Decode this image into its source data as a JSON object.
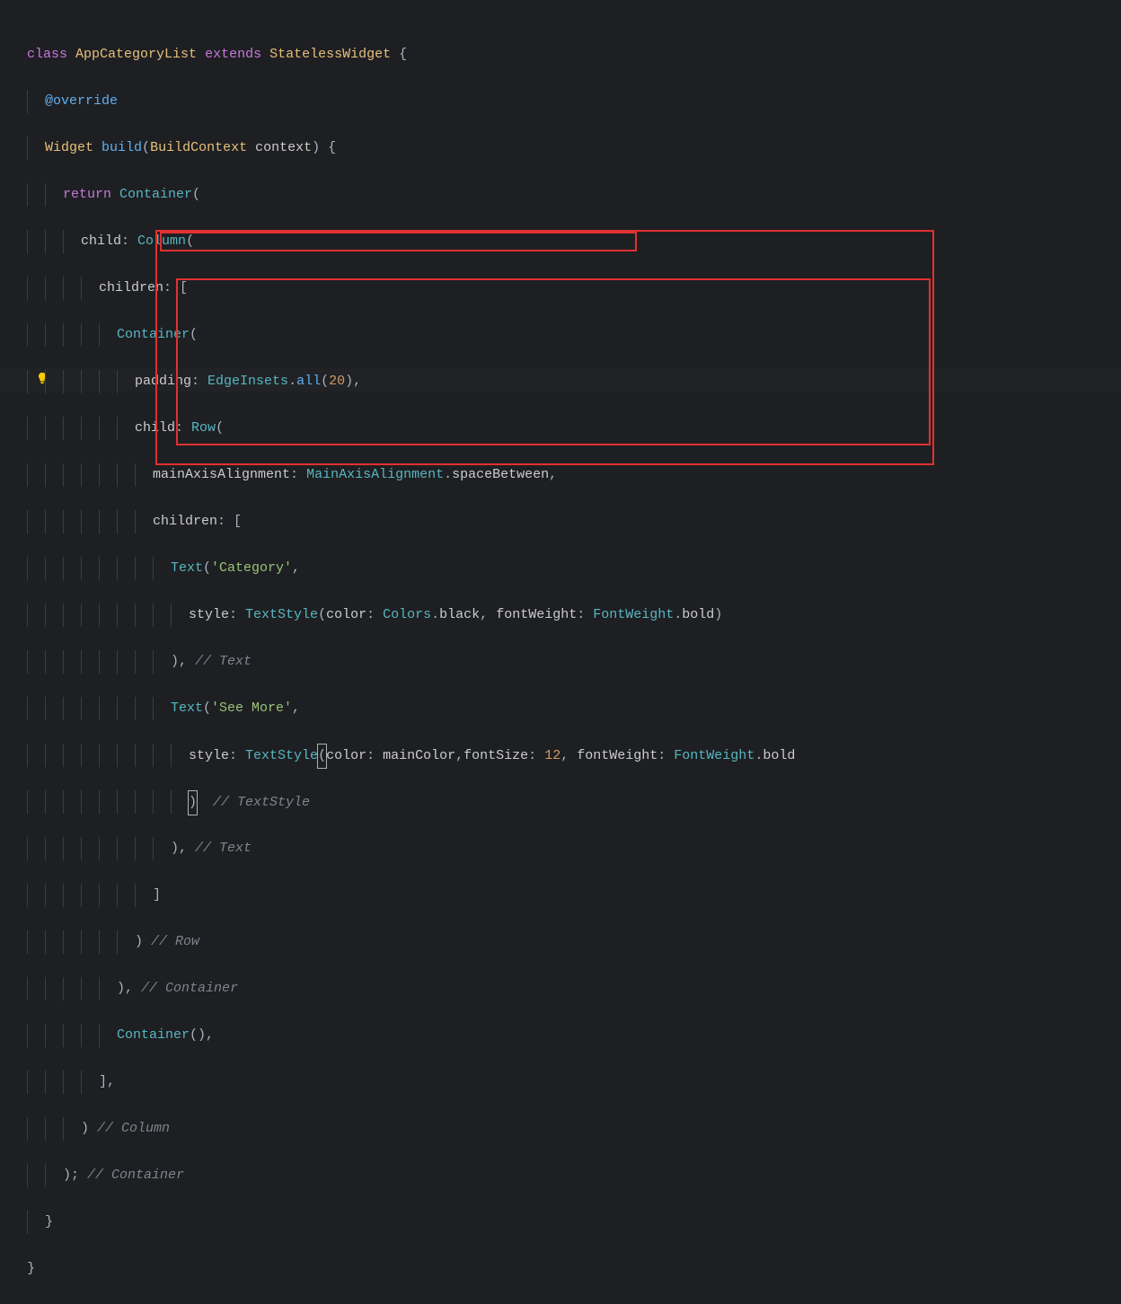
{
  "gutter": {
    "bulb_icon": "lightbulb"
  },
  "tokens": {
    "kw_class": "class",
    "cls_AppCategoryList": "AppCategoryList",
    "kw_extends": "extends",
    "cls_StatelessWidget": "StatelessWidget",
    "ann_override": "@override",
    "type_Widget": "Widget",
    "m_build": "build",
    "type_BuildContext": "BuildContext",
    "p_context": "context",
    "kw_return": "return",
    "cls_Container": "Container",
    "prop_child": "child",
    "cls_Column": "Column",
    "prop_children": "children",
    "cls_Row": "Row",
    "prop_padding": "padding",
    "cls_EdgeInsets": "EdgeInsets",
    "m_all": "all",
    "num_20": "20",
    "prop_mainAxisAlignment": "mainAxisAlignment",
    "cls_MainAxisAlignment": "MainAxisAlignment",
    "v_spaceBetween": "spaceBetween",
    "cls_Text": "Text",
    "str_Category": "'Category'",
    "prop_style": "style",
    "cls_TextStyle": "TextStyle",
    "prop_color": "color",
    "cls_Colors": "Colors",
    "v_black": "black",
    "prop_fontWeight": "fontWeight",
    "cls_FontWeight": "FontWeight",
    "v_bold": "bold",
    "str_SeeMore": "'See More'",
    "v_mainColor": "mainColor",
    "prop_fontSize": "fontSize",
    "num_12": "12",
    "cmt_Text": "// Text",
    "cmt_TextStyle": "// TextStyle",
    "cmt_Row": "// Row",
    "cmt_Container": "// Container",
    "cmt_Column": "// Column",
    "open_brace": "{",
    "close_brace": "}",
    "open_paren": "(",
    "close_paren": ")",
    "open_bracket": "[",
    "close_bracket": "]",
    "comma": ",",
    "colon": ":",
    "semi": ";",
    "dot": ".",
    "space": " "
  }
}
